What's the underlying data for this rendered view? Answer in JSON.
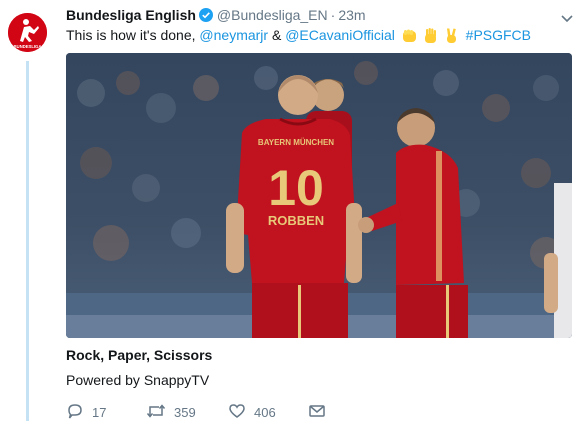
{
  "author": {
    "name": "Bundesliga English",
    "handle": "@Bundesliga_EN",
    "time": "23m",
    "avatar_label": "BUNDESLIGA",
    "verified": true
  },
  "tweet": {
    "prefix": "This is how it's done,",
    "mention_1": "@neymarjr",
    "ampersand": "&",
    "mention_2": "@ECavaniOfficial",
    "emojis": [
      "fist-emoji",
      "raised-hand-emoji",
      "victory-hand-emoji"
    ],
    "hashtag": "#PSGFCB"
  },
  "media": {
    "jersey_number": "10",
    "jersey_name": "ROBBEN",
    "jersey_brand": "BAYERN MÜNCHEN",
    "kit_color": "#c0121f"
  },
  "card": {
    "title": "Rock, Paper, Scissors",
    "subtitle": "Powered by SnappyTV"
  },
  "actions": {
    "reply_count": "17",
    "retweet_count": "359",
    "like_count": "406"
  },
  "colors": {
    "accent": "#1b95e0",
    "muted": "#657786",
    "thread_line": "#c5e2f5"
  }
}
